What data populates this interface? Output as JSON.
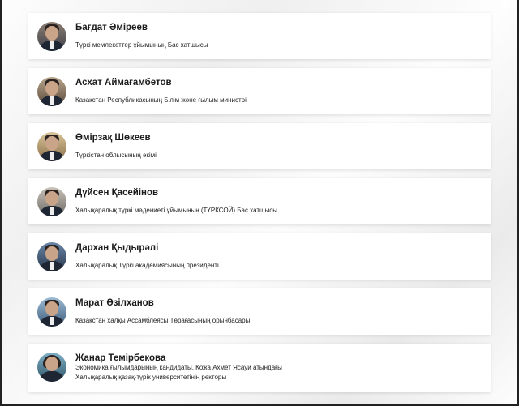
{
  "people": [
    {
      "name": "Бағдат Әміреев",
      "role": "Түркі мемлекеттер ұйымының Бас хатшысы"
    },
    {
      "name": "Асхат Аймағамбетов",
      "role": "Қазақстан Республикасының Білім және ғылым министрі"
    },
    {
      "name": "Өмірзақ Шөкеев",
      "role": "Түркістан облысының әкімі"
    },
    {
      "name": "Дүйсен Қасейінов",
      "role": "Халықаралық түркі мәдениеті ұйымының (ТҮРКСОЙ) Бас хатшысы"
    },
    {
      "name": "Дархан Қыдырәлі",
      "role": "Халықаралық Түркі академиясының президенті"
    },
    {
      "name": "Марат Әзілханов",
      "role": "Қазақстан халқы Ассамблеясы Төрағасының орынбасары"
    },
    {
      "name": "Жанар Темірбекова",
      "role_line1": "Экономика ғылымдарының кандидаты, Қожа Ахмет Ясауи атындағы",
      "role_line2": "Халықаралық қазақ-түрік университетінің ректоры"
    }
  ]
}
